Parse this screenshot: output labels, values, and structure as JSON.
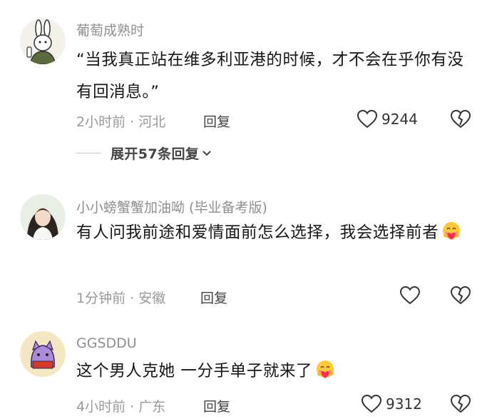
{
  "comments": [
    {
      "username": "葡萄成熟时",
      "text": "“当我真正站在维多利亚港的时候，才不会在乎你有没有回消息。”",
      "time_location": "2小时前 · 河北",
      "reply_label": "回复",
      "likes": "9244",
      "replies_expand_label": "展开57条回复"
    },
    {
      "username": "小小螃蟹蟹加油呦 (毕业备考版)",
      "text": "有人问我前途和爱情面前怎么选择，我会选择前者",
      "time_location": "1分钟前 · 安徽",
      "reply_label": "回复",
      "likes": ""
    },
    {
      "username": "GGSDDU",
      "text": "这个男人克她 一分手单子就来了",
      "time_location": "4小时前 · 广东",
      "reply_label": "回复",
      "likes": "9312"
    }
  ],
  "icons": [
    "heart-outline-icon",
    "broken-heart-icon",
    "chevron-down-icon",
    "hugging-face-emoji"
  ]
}
